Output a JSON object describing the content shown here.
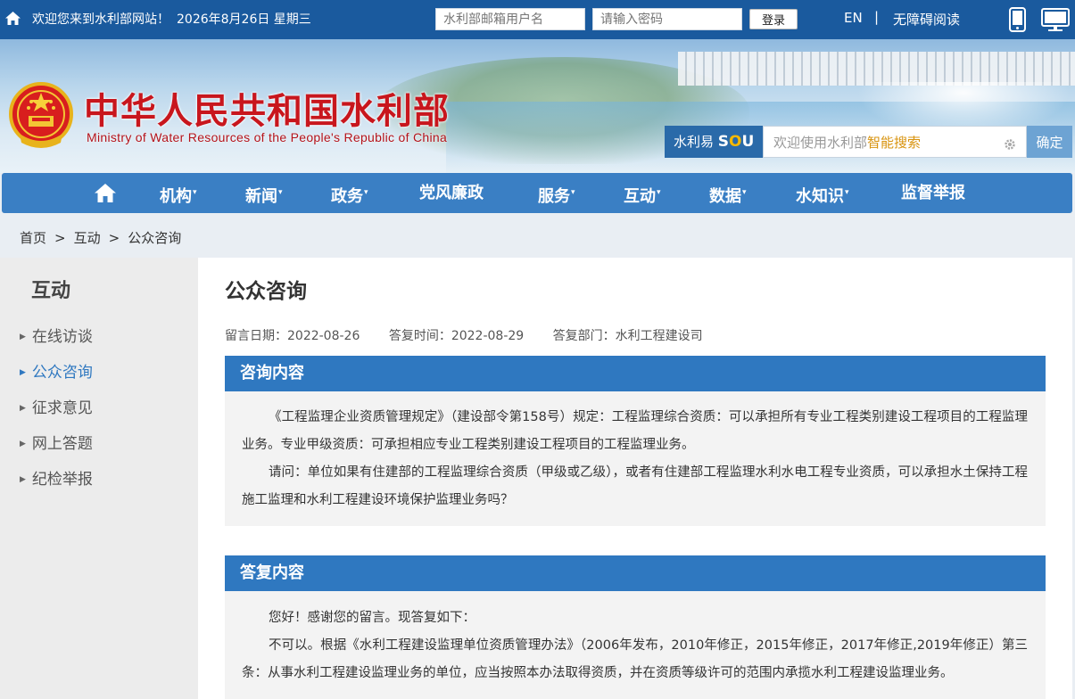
{
  "topbar": {
    "welcome": "欢迎您来到水利部网站！",
    "date": "2026年8月26日 星期三",
    "username_placeholder": "水利部邮箱用户名",
    "password_placeholder": "请输入密码",
    "login_label": "登录",
    "en_label": "EN",
    "separator": "|",
    "accessibility_label": "无障碍阅读"
  },
  "banner": {
    "title_cn": "中华人民共和国水利部",
    "title_en": "Ministry of Water Resources of the People's Republic of China"
  },
  "search": {
    "brand_prefix": "水利易",
    "brand_s": "S",
    "brand_o": "O",
    "brand_u": "U",
    "hint_prefix": "欢迎使用水利部",
    "hint_highlight": "智能搜索",
    "submit_label": "确定"
  },
  "nav": {
    "items": [
      {
        "label": "机构",
        "has_menu": true
      },
      {
        "label": "新闻",
        "has_menu": true
      },
      {
        "label": "政务",
        "has_menu": true
      },
      {
        "label": "党风廉政",
        "has_menu": false
      },
      {
        "label": "服务",
        "has_menu": true
      },
      {
        "label": "互动",
        "has_menu": true
      },
      {
        "label": "数据",
        "has_menu": true
      },
      {
        "label": "水知识",
        "has_menu": true
      },
      {
        "label": "监督举报",
        "has_menu": false
      }
    ],
    "caret": "▾"
  },
  "breadcrumb": {
    "items": [
      "首页",
      "互动",
      "公众咨询"
    ],
    "separator": ">"
  },
  "sidebar": {
    "title": "互动",
    "arrow": "▶",
    "items": [
      "在线访谈",
      "公众咨询",
      "征求意见",
      "网上答题",
      "纪检举报"
    ],
    "active_index": 1
  },
  "main": {
    "title": "公众咨询",
    "meta": {
      "message_date": "留言日期：2022-08-26",
      "reply_date": "答复时间：2022-08-29",
      "department": "答复部门：水利工程建设司"
    },
    "inquiry": {
      "heading": "咨询内容",
      "paragraphs": [
        "《工程监理企业资质管理规定》（建设部令第158号）规定：工程监理综合资质：可以承担所有专业工程类别建设工程项目的工程监理业务。专业甲级资质：可承担相应专业工程类别建设工程项目的工程监理业务。",
        "请问：单位如果有住建部的工程监理综合资质（甲级或乙级），或者有住建部工程监理水利水电工程专业资质，可以承担水土保持工程施工监理和水利工程建设环境保护监理业务吗？"
      ]
    },
    "reply": {
      "heading": "答复内容",
      "paragraphs": [
        "您好！感谢您的留言。现答复如下：",
        "不可以。根据《水利工程建设监理单位资质管理办法》（2006年发布，2010年修正，2015年修正，2017年修正,2019年修正）第三条：从事水利工程建设监理业务的单位，应当按照本办法取得资质，并在资质等级许可的范围内承揽水利工程建设监理业务。"
      ]
    }
  },
  "colors": {
    "topbar": "#1a5a9e",
    "nav": "#3a7fc4",
    "section_head": "#2f78c0",
    "title_red": "#c8161d",
    "active_link": "#2f78c0"
  },
  "icons": {
    "top_home": "home-icon",
    "mobile": "phone-icon",
    "desktop": "desktop-icon",
    "emblem": "national-emblem-icon",
    "nav_home": "nav-home-icon",
    "search_gear": "gear-icon"
  }
}
